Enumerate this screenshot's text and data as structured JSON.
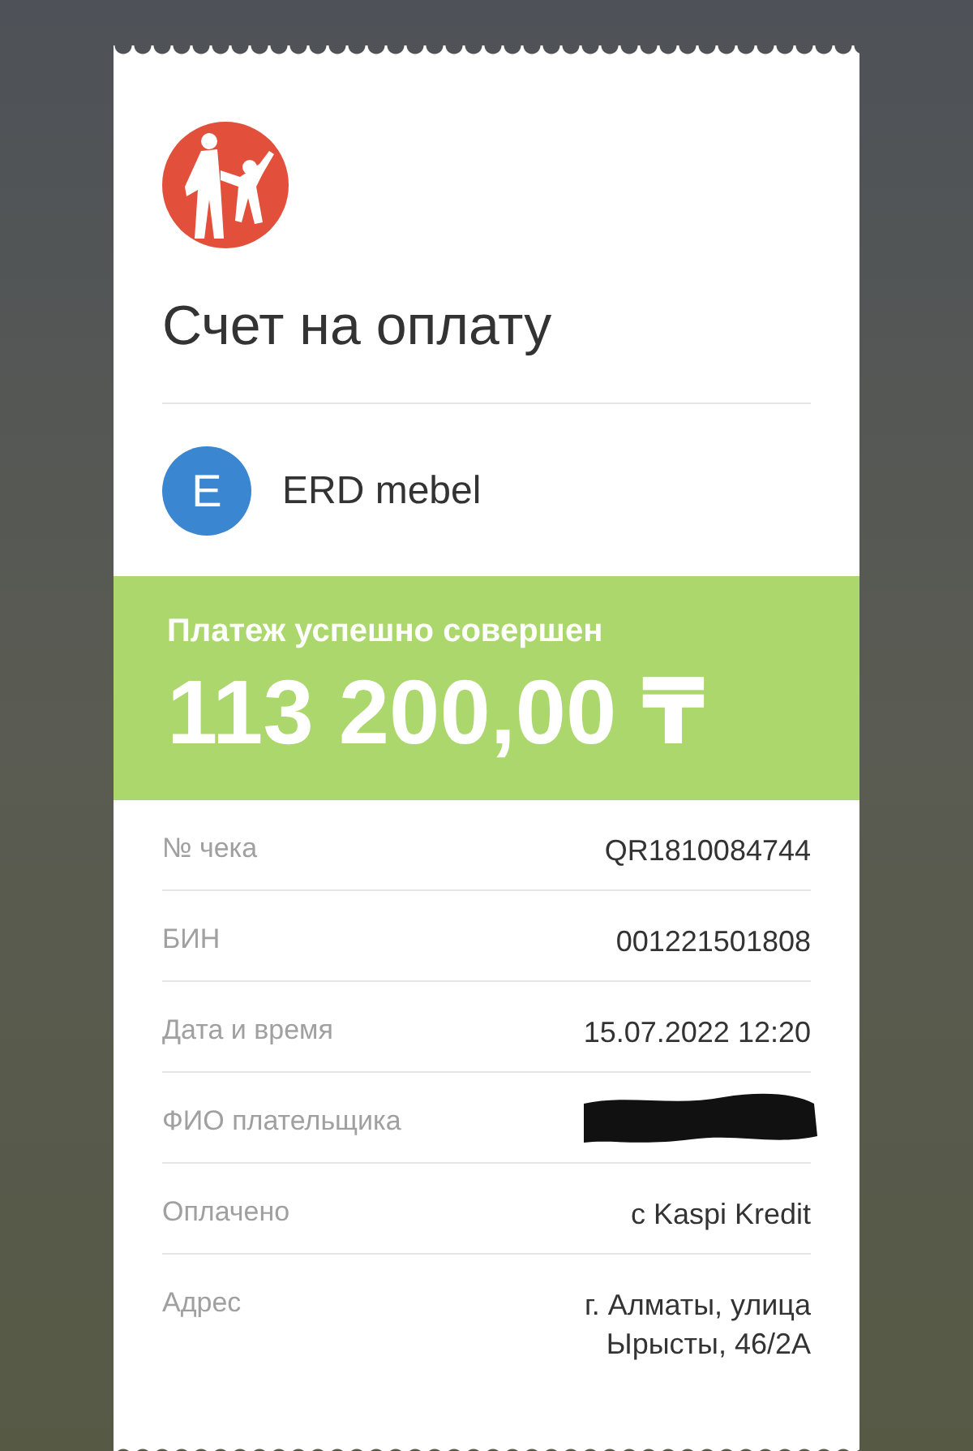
{
  "title": "Счет на оплату",
  "merchant": {
    "initial": "E",
    "name": "ERD mebel"
  },
  "status": {
    "message": "Платеж успешно совершен",
    "amount": "113 200,00 ₸"
  },
  "details": [
    {
      "label": "№ чека",
      "value": "QR1810084744",
      "redacted": false
    },
    {
      "label": "БИН",
      "value": "001221501808",
      "redacted": false
    },
    {
      "label": "Дата и время",
      "value": "15.07.2022 12:20",
      "redacted": false
    },
    {
      "label": "ФИО плательщика",
      "redacted": true
    },
    {
      "label": "Оплачено",
      "value": "с Kaspi Kredit",
      "redacted": false
    },
    {
      "label": "Адрес",
      "value": "г. Алматы, улица Ырысты, 46/2А",
      "redacted": false
    }
  ]
}
